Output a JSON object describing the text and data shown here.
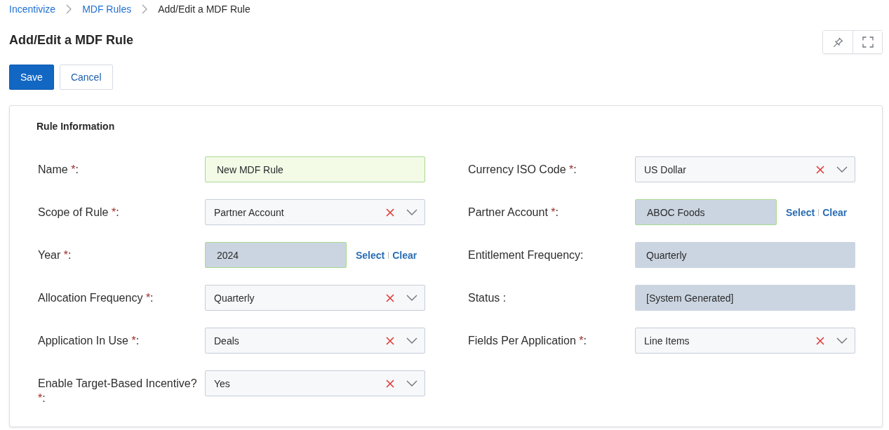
{
  "breadcrumb": [
    {
      "label": "Incentivize",
      "kind": "link"
    },
    {
      "label": "MDF Rules",
      "kind": "link"
    },
    {
      "label": "Add/Edit a MDF Rule",
      "kind": "current"
    }
  ],
  "page_title": "Add/Edit a MDF Rule",
  "actions": [
    {
      "label": "Save",
      "kind": "primary"
    },
    {
      "label": "Cancel",
      "kind": "secondary"
    }
  ],
  "required_mark": "*",
  "section": {
    "title": "Rule Information",
    "left_fields": [
      {
        "label": "Name",
        "required": true,
        "suffix": ":",
        "kind": "text",
        "value": "New MDF Rule"
      },
      {
        "label": "Scope of Rule",
        "required": true,
        "suffix": ":",
        "kind": "select",
        "value": "Partner Account"
      },
      {
        "label": "Year",
        "required": true,
        "suffix": ":",
        "kind": "lookup",
        "value": "2024",
        "links": [
          "Select",
          "Clear"
        ]
      },
      {
        "label": "Allocation Frequency",
        "required": true,
        "suffix": ":",
        "kind": "select",
        "value": "Quarterly"
      },
      {
        "label": "Application In Use",
        "required": true,
        "suffix": ":",
        "kind": "select",
        "value": "Deals"
      },
      {
        "label": "Enable Target-Based Incentive?",
        "required": true,
        "suffix": ":",
        "kind": "select",
        "value": "Yes"
      }
    ],
    "right_fields": [
      {
        "label": "Currency ISO Code",
        "required": true,
        "suffix": ":",
        "kind": "select",
        "value": "US Dollar"
      },
      {
        "label": "Partner Account",
        "required": true,
        "suffix": ":",
        "kind": "lookup",
        "value": "ABOC Foods",
        "links": [
          "Select",
          "Clear"
        ]
      },
      {
        "label": "Entitlement Frequency",
        "required": false,
        "suffix": ":",
        "kind": "readonly",
        "value": "Quarterly"
      },
      {
        "label": "Status",
        "required": false,
        "suffix": " :",
        "kind": "readonly",
        "value": "[System Generated]"
      },
      {
        "label": "Fields Per Application",
        "required": true,
        "suffix": ":",
        "kind": "select",
        "value": "Line Items"
      }
    ]
  }
}
